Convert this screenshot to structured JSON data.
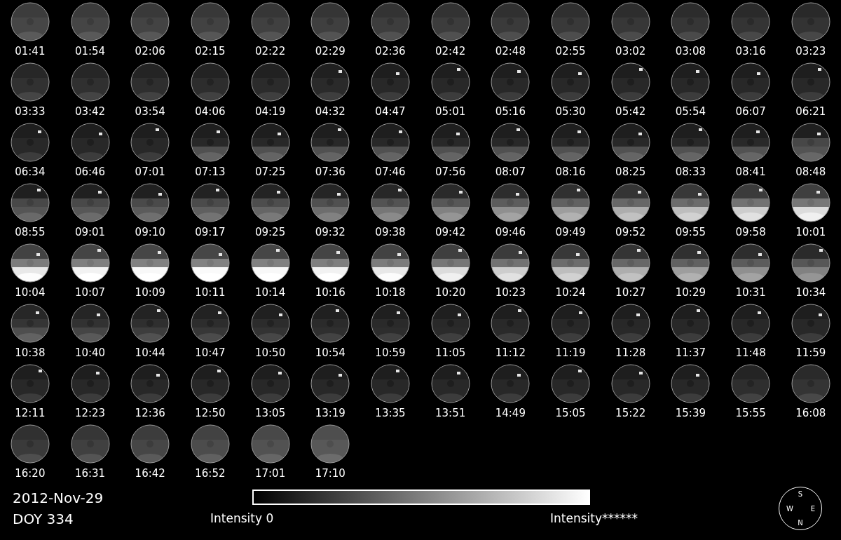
{
  "frames": [
    "01:41",
    "01:54",
    "02:06",
    "02:15",
    "02:22",
    "02:29",
    "02:36",
    "02:42",
    "02:48",
    "02:55",
    "03:02",
    "03:08",
    "03:16",
    "03:23",
    "03:33",
    "03:42",
    "03:54",
    "04:06",
    "04:19",
    "04:32",
    "04:47",
    "05:01",
    "05:16",
    "05:30",
    "05:42",
    "05:54",
    "06:07",
    "06:21",
    "06:34",
    "06:46",
    "07:01",
    "07:13",
    "07:25",
    "07:36",
    "07:46",
    "07:56",
    "08:07",
    "08:16",
    "08:25",
    "08:33",
    "08:41",
    "08:48",
    "08:55",
    "09:01",
    "09:10",
    "09:17",
    "09:25",
    "09:32",
    "09:38",
    "09:42",
    "09:46",
    "09:49",
    "09:52",
    "09:55",
    "09:58",
    "10:01",
    "10:04",
    "10:07",
    "10:09",
    "10:11",
    "10:14",
    "10:16",
    "10:18",
    "10:20",
    "10:23",
    "10:24",
    "10:27",
    "10:29",
    "10:31",
    "10:34",
    "10:38",
    "10:40",
    "10:44",
    "10:47",
    "10:50",
    "10:54",
    "10:59",
    "11:05",
    "11:12",
    "11:19",
    "11:28",
    "11:37",
    "11:48",
    "11:59",
    "12:11",
    "12:23",
    "12:36",
    "12:50",
    "13:05",
    "13:19",
    "13:35",
    "13:51",
    "14:49",
    "15:05",
    "15:22",
    "15:39",
    "15:55",
    "16:08",
    "16:20",
    "16:31",
    "16:42",
    "16:52",
    "17:01",
    "17:10"
  ],
  "date": "2012-Nov-29",
  "doy": "DOY 334",
  "colorbar": {
    "min_label": "Intensity 0",
    "max_label": "Intensity******"
  },
  "compass": {
    "top": "S",
    "left": "W",
    "right": "E",
    "bottom": "N"
  }
}
